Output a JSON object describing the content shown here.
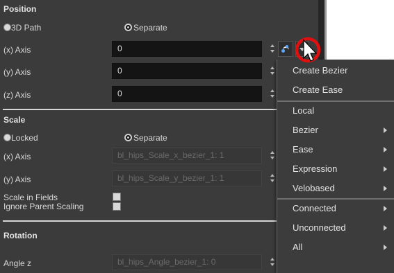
{
  "position": {
    "header": "Position",
    "radio_3d_path": "3D Path",
    "radio_separate": "Separate",
    "x_label": "(x) Axis",
    "y_label": "(y) Axis",
    "z_label": "(z) Axis",
    "x_value": "0",
    "y_value": "0",
    "z_value": "0"
  },
  "scale": {
    "header": "Scale",
    "radio_locked": "Locked",
    "radio_separate": "Separate",
    "x_label": "(x) Axis",
    "y_label": "(y) Axis",
    "x_value": "bl_hips_Scale_x_bezier_1: 1",
    "y_value": "bl_hips_Scale_y_bezier_1: 1",
    "scale_in_fields": "Scale in Fields",
    "ignore_parent_scaling": "Ignore Parent Scaling"
  },
  "rotation": {
    "header": "Rotation",
    "angle_label": "Angle z",
    "angle_value": "bl_hips_Angle_bezier_1: 0"
  },
  "context_menu": {
    "items": [
      {
        "label": "Create Bezier",
        "submenu": false
      },
      {
        "label": "Create Ease",
        "submenu": false
      },
      {
        "label": "Local",
        "submenu": false
      },
      {
        "label": "Bezier",
        "submenu": true
      },
      {
        "label": "Ease",
        "submenu": true
      },
      {
        "label": "Expression",
        "submenu": true
      },
      {
        "label": "Velobased",
        "submenu": true
      },
      {
        "label": "Connected",
        "submenu": true
      },
      {
        "label": "Unconnected",
        "submenu": true
      },
      {
        "label": "All",
        "submenu": true
      }
    ]
  },
  "colors": {
    "panel_bg": "#3b3b3b",
    "field_bg": "#141414",
    "highlight_circle": "#e01010",
    "function_icon": "#5aa7ff"
  },
  "icons": [
    "function-curve-icon",
    "dropdown-arrow-icon",
    "mouse-cursor-icon",
    "submenu-arrow-icon"
  ]
}
